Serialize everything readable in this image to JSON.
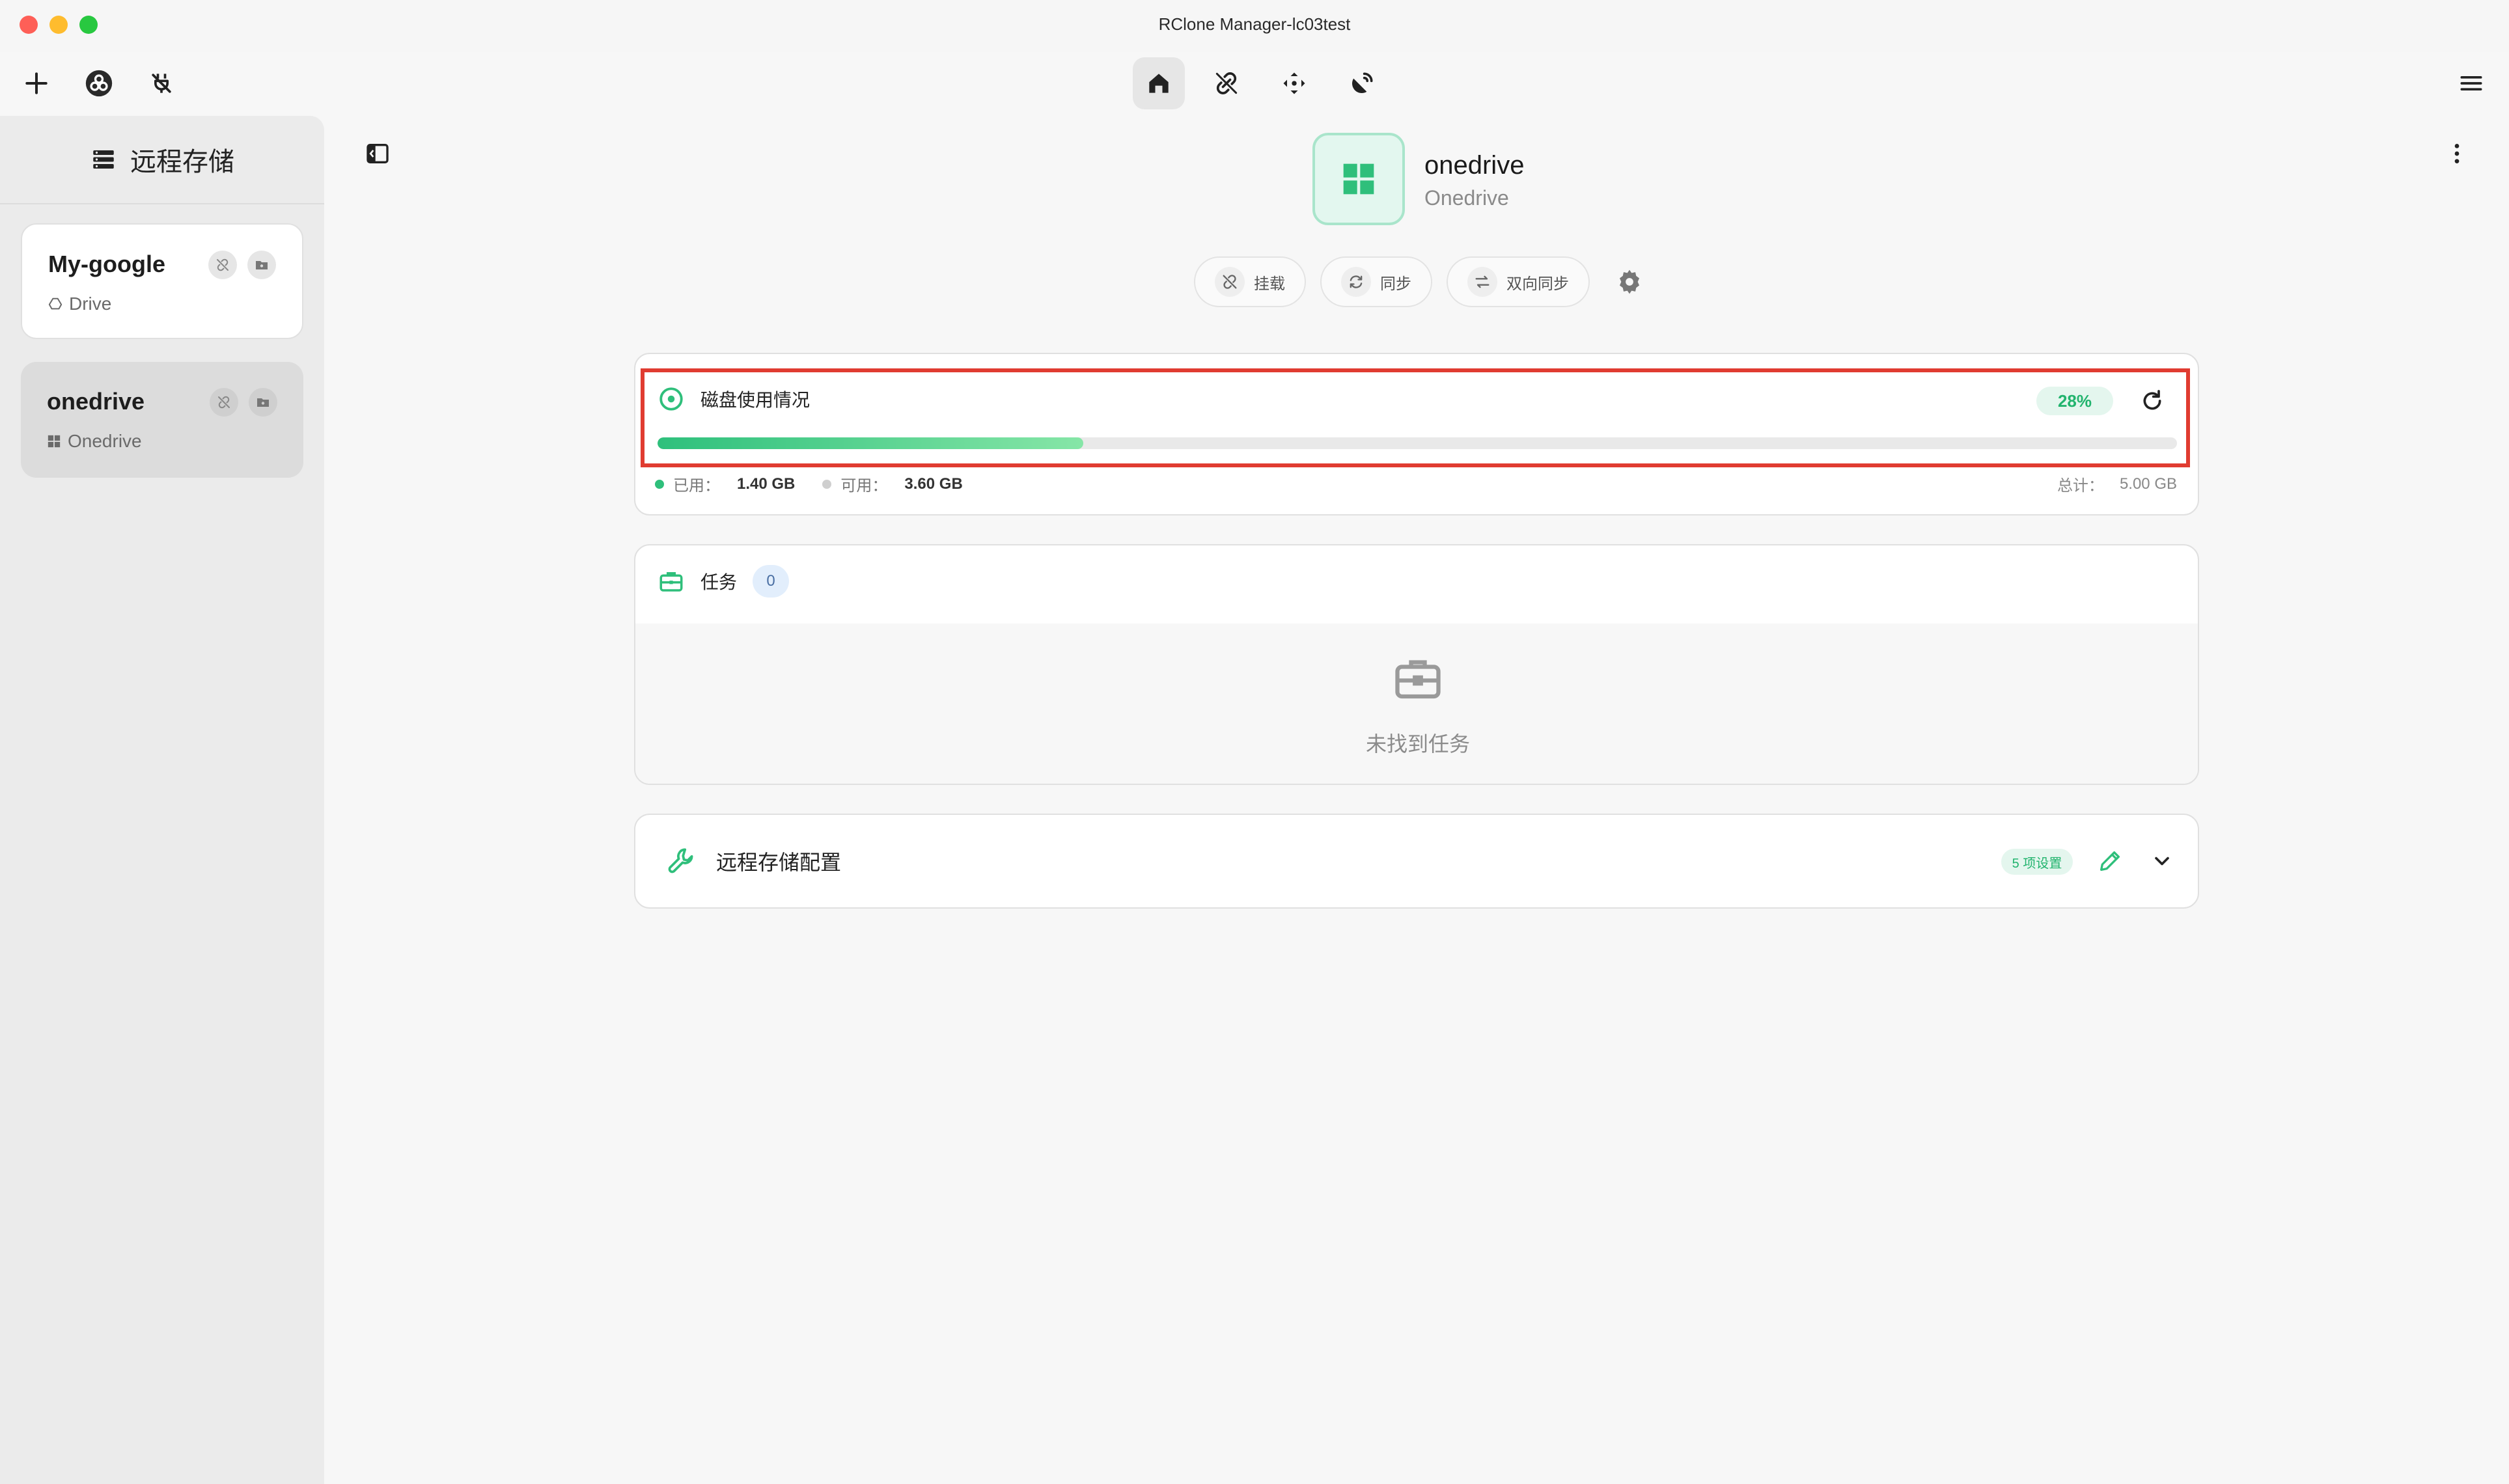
{
  "window": {
    "title": "RClone Manager-lc03test"
  },
  "toolbar": {
    "left_icons": [
      "plus-icon",
      "rclone-logo-icon",
      "disconnect-icon"
    ],
    "nav_tabs": [
      {
        "name": "home",
        "icon": "home-icon",
        "active": true
      },
      {
        "name": "mount",
        "icon": "link-icon",
        "active": false
      },
      {
        "name": "sync",
        "icon": "move-arrows-icon",
        "active": false
      },
      {
        "name": "serve",
        "icon": "broadcast-icon",
        "active": false
      }
    ],
    "right_icon": "menu-icon"
  },
  "sidebar": {
    "title": "远程存储",
    "remotes": [
      {
        "name": "My-google",
        "type": "Drive",
        "icon": "google-drive-icon",
        "selected": false
      },
      {
        "name": "onedrive",
        "type": "Onedrive",
        "icon": "windows-icon",
        "selected": true
      }
    ]
  },
  "main": {
    "remote_name": "onedrive",
    "remote_type": "Onedrive",
    "actions": [
      {
        "label": "挂载",
        "icon": "mount-icon"
      },
      {
        "label": "同步",
        "icon": "sync-icon"
      },
      {
        "label": "双向同步",
        "icon": "bisync-icon"
      }
    ],
    "disk": {
      "title": "磁盘使用情况",
      "percent_label": "28%",
      "used_fraction": 0.28,
      "used_label": "已用：",
      "used_value": "1.40 GB",
      "free_label": "可用：",
      "free_value": "3.60 GB",
      "total_label": "总计：",
      "total_value": "5.00 GB"
    },
    "tasks": {
      "title": "任务",
      "count": "0",
      "empty_text": "未找到任务"
    },
    "config": {
      "title": "远程存储配置",
      "badge": "5 项设置"
    }
  },
  "colors": {
    "accent": "#22b46e",
    "highlight": "#e03c31",
    "close": "#fe5f57",
    "minimize": "#febc2e",
    "maximize": "#28c840"
  }
}
